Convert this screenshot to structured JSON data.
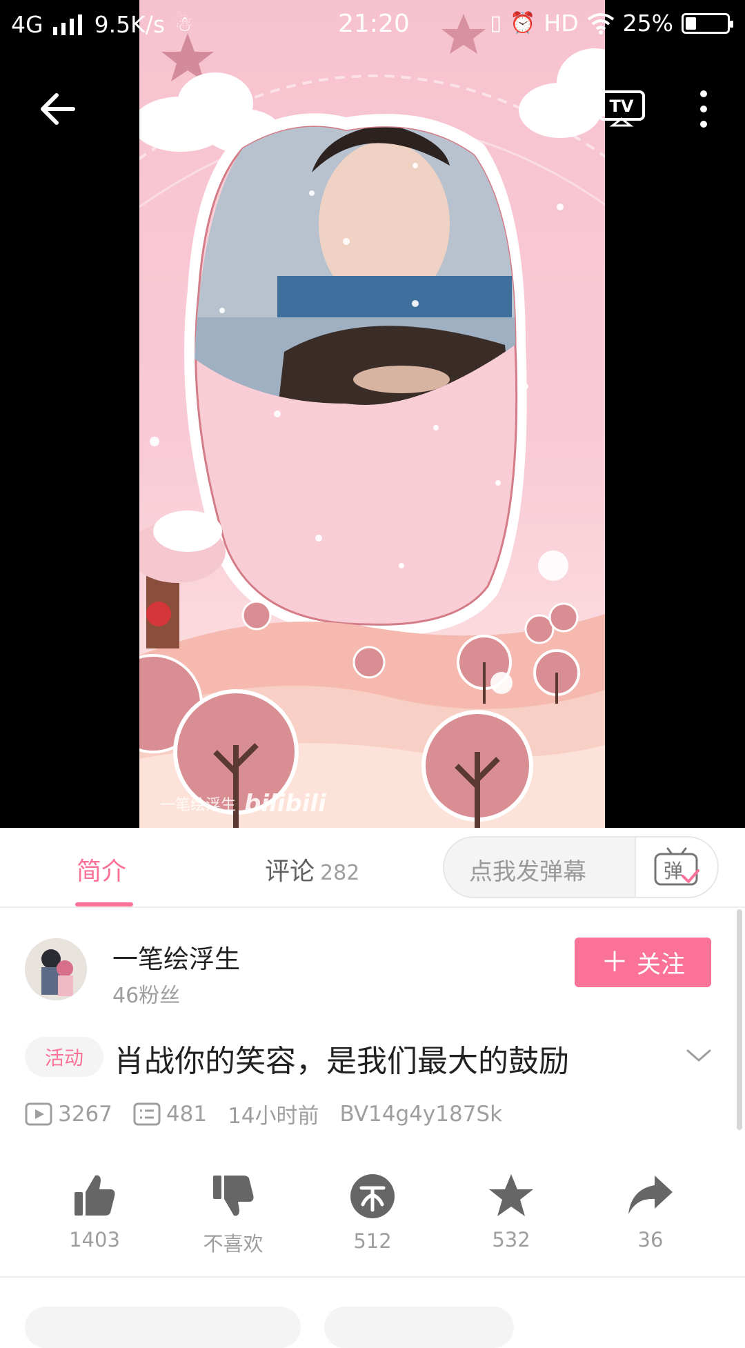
{
  "status_bar": {
    "network": "4G",
    "speed": "9.5K/s",
    "time": "21:20",
    "hd": "HD",
    "battery": "25%",
    "battery_level": 0.25
  },
  "player": {
    "watermark_text": "一笔绘浮生",
    "watermark_logo": "bilibili"
  },
  "tabs": {
    "intro_label": "简介",
    "comments_label": "评论",
    "comments_count": "282",
    "danmaku_placeholder": "点我发弹幕"
  },
  "uploader": {
    "name": "一笔绘浮生",
    "fans": "46粉丝",
    "follow_label": "关注"
  },
  "video": {
    "tag": "活动",
    "title": "肖战你的笑容，是我们最大的鼓励",
    "views": "3267",
    "danmaku_count": "481",
    "time_ago": "14小时前",
    "bvid": "BV14g4y187Sk"
  },
  "actions": {
    "like": "1403",
    "dislike": "不喜欢",
    "coin": "512",
    "favorite": "532",
    "share": "36"
  },
  "colors": {
    "accent": "#fb7299"
  }
}
